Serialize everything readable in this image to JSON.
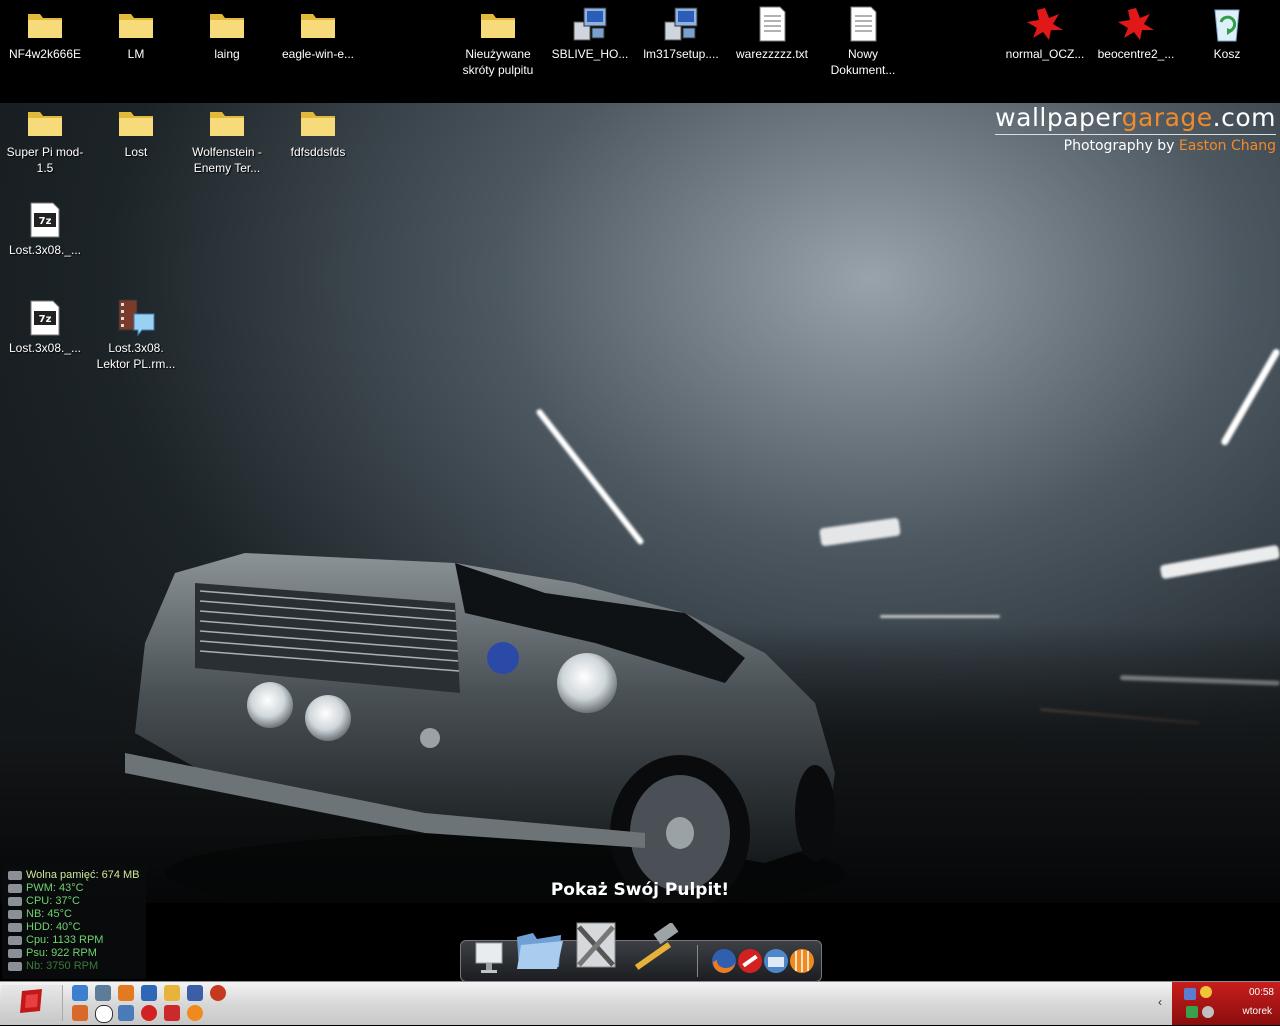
{
  "desktop": {
    "icons": [
      {
        "label": "NF4w2k666E",
        "type": "folder"
      },
      {
        "label": "LM",
        "type": "folder"
      },
      {
        "label": "laing",
        "type": "folder"
      },
      {
        "label": "eagle-win-e...",
        "type": "folder"
      },
      {
        "label": "Nieużywane skróty pulpitu",
        "type": "folder"
      },
      {
        "label": "SBLIVE_HO...",
        "type": "installer"
      },
      {
        "label": "lm317setup....",
        "type": "installer"
      },
      {
        "label": "warezzzzz.txt",
        "type": "text-file"
      },
      {
        "label": "Nowy Dokument...",
        "type": "text-file"
      },
      {
        "label": "normal_OCZ...",
        "type": "image-file"
      },
      {
        "label": "beocentre2_...",
        "type": "image-file"
      },
      {
        "label": "Kosz",
        "type": "recycle-bin"
      },
      {
        "label": "Super Pi mod-1.5",
        "type": "folder"
      },
      {
        "label": "Lost",
        "type": "folder"
      },
      {
        "label": "Wolfenstein - Enemy Ter...",
        "type": "folder"
      },
      {
        "label": "fdfsddsfds",
        "type": "folder"
      },
      {
        "label": "Lost.3x08._...",
        "type": "7z-archive"
      },
      {
        "label": "Lost.3x08._...",
        "type": "7z-archive"
      },
      {
        "label": "Lost.3x08. Lektor PL.rm...",
        "type": "video-file"
      }
    ]
  },
  "wallpaper": {
    "brand_prefix": "wallpaper",
    "brand_highlight": "garage",
    "brand_suffix": ".com",
    "credit_prefix": "Photography by",
    "credit_name": "Easton Chang"
  },
  "sysmon": {
    "rows": [
      {
        "text": "Wolna pamięć: 674 MB",
        "icon": "memory-icon"
      },
      {
        "text": "PWM: 43°C",
        "icon": "pwm-icon"
      },
      {
        "text": "CPU: 37°C",
        "icon": "cpu-icon"
      },
      {
        "text": "NB: 45°C",
        "icon": "chip-icon"
      },
      {
        "text": "HDD: 40°C",
        "icon": "hdd-icon"
      },
      {
        "text": "Cpu: 1133 RPM",
        "icon": "fan-icon"
      },
      {
        "text": "Psu: 922 RPM",
        "icon": "psu-icon"
      },
      {
        "text": "Nb: 3750 RPM",
        "icon": "fan-icon"
      }
    ]
  },
  "dock": {
    "caption": "Pokaż Swój Pulpit!",
    "items": [
      "show-desktop-icon",
      "folder-icon",
      "tools-icon",
      "hammer-icon",
      "firefox-icon",
      "antivirus-icon",
      "mail-icon",
      "media-icon"
    ]
  },
  "taskbar": {
    "tray_arrow": "‹",
    "clock": "00:58",
    "day": "wtorek"
  },
  "colors": {
    "tray_red": "#c81e1e",
    "brand_orange": "#f08a2a",
    "sysmon_green": "#6fd46f"
  }
}
